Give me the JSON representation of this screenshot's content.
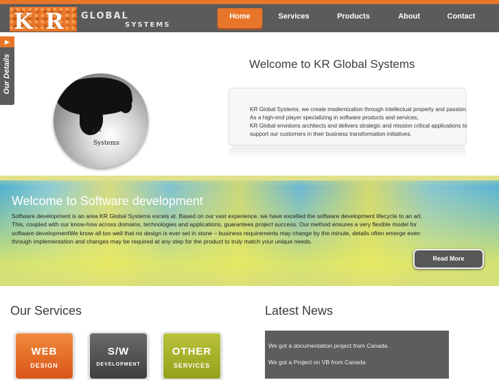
{
  "brand": {
    "logo_letters": [
      "K",
      "R"
    ],
    "line1": "GLOBAL",
    "line2": "SYSTEMS"
  },
  "nav": {
    "items": [
      "Home",
      "Services",
      "Products",
      "About",
      "Contact"
    ],
    "active": "Home"
  },
  "side_tab": {
    "label": "Our Details",
    "arrow": "▶"
  },
  "hero": {
    "globe_text": [
      "KR",
      "Systems"
    ],
    "title": "Welcome to KR Global Systems",
    "lines": [
      "KR Global Systems, we create modernization through intellectual property and passion.",
      "As a high-end player specializing in software products and services,",
      "KR Global envisions architects and delivers strategic and mission critical applications to",
      "support our customers in their business transformation initiatives."
    ]
  },
  "software_band": {
    "title": "Welcome to Software development",
    "lines": [
      "Software development is an area KR Global Systems excels at. Based on our vast experience, we have excelled the software development lifecycle to an art.",
      "This, coupled with our know-how across domains, technologies and applications, guarantees project success. Our method ensures a very flexible model for",
      "software developmentWe know all too well that no design is ever set in stone – business requirements may change by the minute, details often emerge even",
      "through implementation and changes may be required at any step for the product to truly match your unique needs."
    ],
    "button": "Read More"
  },
  "services": {
    "title": "Our Services",
    "tiles": [
      {
        "line1": "WEB",
        "line2": "DESIGN"
      },
      {
        "line1": "S/W",
        "line2": "DEVELOPMENT"
      },
      {
        "line1": "OTHER",
        "line2": "SERVICES"
      }
    ]
  },
  "news": {
    "title": "Latest News",
    "items": [
      "We got a documentation project from Canada.",
      "We got a Project on VB from Canada"
    ]
  },
  "colors": {
    "accent": "#e8762a",
    "topbar": "#5b5b5b",
    "button": "#575757"
  }
}
